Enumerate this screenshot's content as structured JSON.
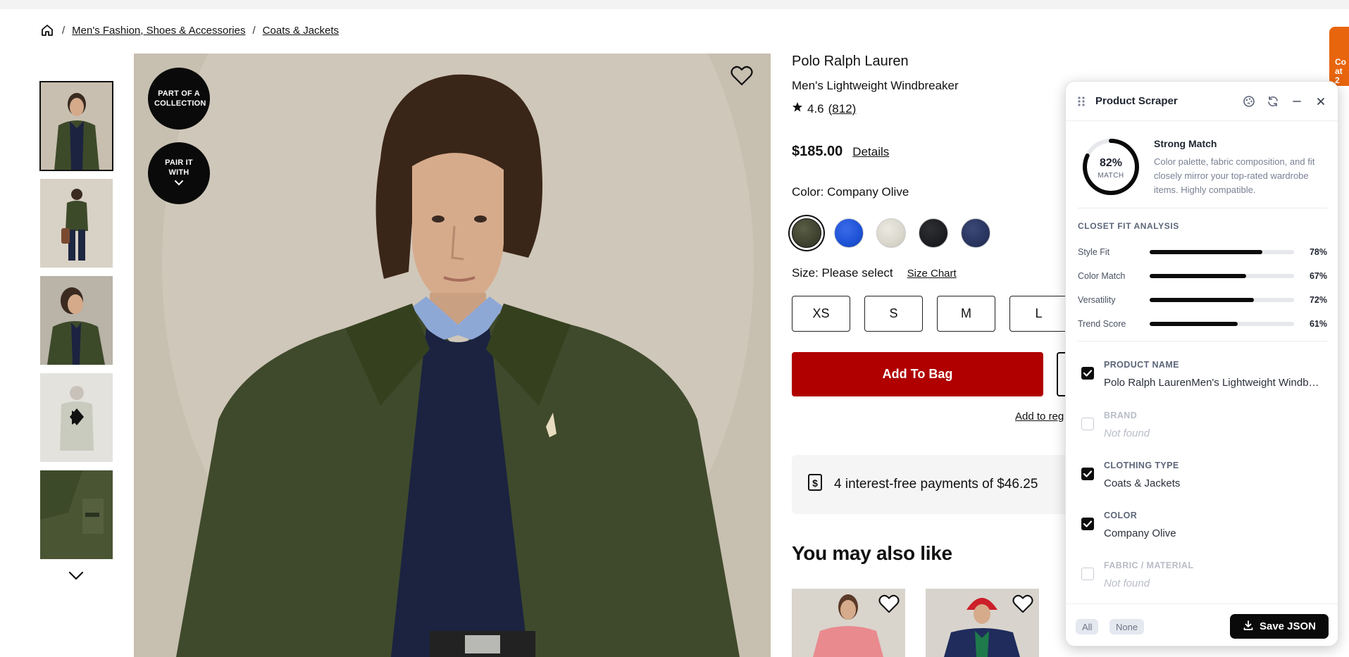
{
  "breadcrumb": {
    "items": [
      "Men's Fashion, Shoes & Accessories",
      "Coats & Jackets"
    ]
  },
  "hero": {
    "badge_collection": "PART OF A COLLECTION",
    "badge_pair": "PAIR IT WITH"
  },
  "product": {
    "brand": "Polo Ralph Lauren",
    "name": "Men's Lightweight Windbreaker",
    "rating": "4.6",
    "review_count": "(812)",
    "price": "$185.00",
    "details_label": "Details",
    "color_label": "Color: Company Olive",
    "swatch_colors": [
      "#3e4230",
      "#1d52d6",
      "#d9d6cc",
      "#1a1b1e",
      "#26325a"
    ],
    "size_label": "Size: Please select",
    "size_chart_label": "Size Chart",
    "sizes": [
      "XS",
      "S",
      "M",
      "L"
    ],
    "add_to_bag_label": "Add To Bag",
    "registry_label": "Add to reg",
    "payments_text": "4 interest-free payments of $46.25",
    "also_like_title": "You may also like"
  },
  "promo_tab": {
    "text": "Co at 2"
  },
  "scraper": {
    "title": "Product Scraper",
    "match": {
      "percent": "82%",
      "percent_value": 82,
      "sub": "MATCH",
      "title": "Strong Match",
      "description": "Color palette, fabric composition, and fit closely mirror your top-rated wardrobe items. Highly compatible."
    },
    "analysis_title": "CLOSET FIT ANALYSIS",
    "metrics": [
      {
        "label": "Style Fit",
        "value": 78,
        "pct": "78%"
      },
      {
        "label": "Color Match",
        "value": 67,
        "pct": "67%"
      },
      {
        "label": "Versatility",
        "value": 72,
        "pct": "72%"
      },
      {
        "label": "Trend Score",
        "value": 61,
        "pct": "61%"
      }
    ],
    "fields": [
      {
        "label": "PRODUCT NAME",
        "value": "Polo Ralph LaurenMen's Lightweight Windbreaker",
        "checked": true,
        "found": true
      },
      {
        "label": "BRAND",
        "value": "Not found",
        "checked": false,
        "found": false
      },
      {
        "label": "CLOTHING TYPE",
        "value": "Coats & Jackets",
        "checked": true,
        "found": true
      },
      {
        "label": "COLOR",
        "value": "Company Olive",
        "checked": true,
        "found": true
      },
      {
        "label": "FABRIC / MATERIAL",
        "value": "Not found",
        "checked": false,
        "found": false
      }
    ],
    "footer": {
      "all_label": "All",
      "none_label": "None",
      "save_label": "Save JSON"
    },
    "colors": {
      "accent": "#0a0a0a",
      "label_on": "#5c6578",
      "label_off": "#b9bdc7"
    }
  }
}
